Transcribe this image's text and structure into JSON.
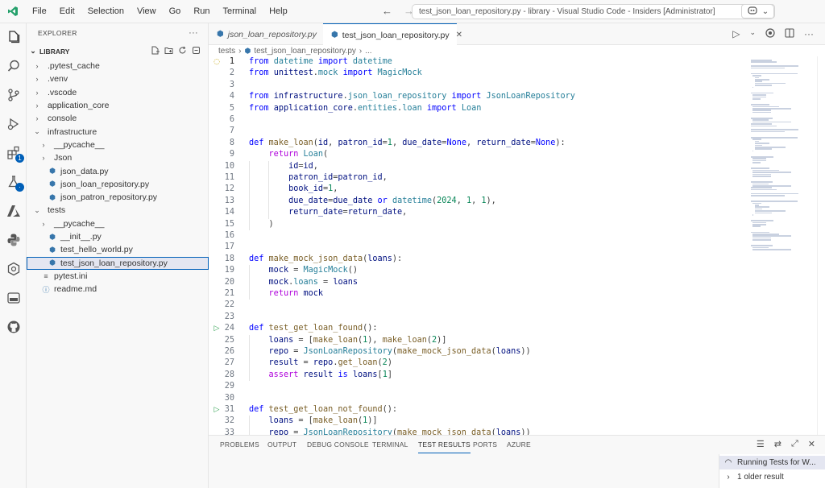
{
  "menu": [
    "File",
    "Edit",
    "Selection",
    "View",
    "Go",
    "Run",
    "Terminal",
    "Help"
  ],
  "command_center": "test_json_loan_repository.py - library - Visual Studio Code - Insiders [Administrator]",
  "explorer": {
    "title": "EXPLORER",
    "section": "LIBRARY",
    "items": [
      {
        "label": ".pytest_cache",
        "kind": "folder",
        "depth": 0,
        "open": false
      },
      {
        "label": ".venv",
        "kind": "folder",
        "depth": 0,
        "open": false
      },
      {
        "label": ".vscode",
        "kind": "folder",
        "depth": 0,
        "open": false
      },
      {
        "label": "application_core",
        "kind": "folder",
        "depth": 0,
        "open": false
      },
      {
        "label": "console",
        "kind": "folder",
        "depth": 0,
        "open": false
      },
      {
        "label": "infrastructure",
        "kind": "folder",
        "depth": 0,
        "open": true
      },
      {
        "label": "__pycache__",
        "kind": "folder",
        "depth": 1,
        "open": false
      },
      {
        "label": "Json",
        "kind": "folder",
        "depth": 1,
        "open": false
      },
      {
        "label": "json_data.py",
        "kind": "py",
        "depth": 1
      },
      {
        "label": "json_loan_repository.py",
        "kind": "py",
        "depth": 1
      },
      {
        "label": "json_patron_repository.py",
        "kind": "py",
        "depth": 1
      },
      {
        "label": "tests",
        "kind": "folder",
        "depth": 0,
        "open": true
      },
      {
        "label": "__pycache__",
        "kind": "folder",
        "depth": 1,
        "open": false
      },
      {
        "label": "__init__.py",
        "kind": "py",
        "depth": 1
      },
      {
        "label": "test_hello_world.py",
        "kind": "py",
        "depth": 1
      },
      {
        "label": "test_json_loan_repository.py",
        "kind": "py",
        "depth": 1,
        "selected": true
      },
      {
        "label": "pytest.ini",
        "kind": "ini",
        "depth": 0
      },
      {
        "label": "readme.md",
        "kind": "md",
        "depth": 0
      }
    ]
  },
  "tabs": [
    {
      "label": "json_loan_repository.py",
      "active": false
    },
    {
      "label": "test_json_loan_repository.py",
      "active": true
    }
  ],
  "breadcrumb": [
    "tests",
    "test_json_loan_repository.py",
    "..."
  ],
  "code": [
    {
      "n": "1",
      "glyph": "bulb",
      "t": "from datetime import datetime"
    },
    {
      "n": "2",
      "t": "from unittest.mock import MagicMock"
    },
    {
      "n": "3",
      "t": ""
    },
    {
      "n": "4",
      "t": "from infrastructure.json_loan_repository import JsonLoanRepository"
    },
    {
      "n": "5",
      "t": "from application_core.entities.loan import Loan"
    },
    {
      "n": "6",
      "t": ""
    },
    {
      "n": "7",
      "t": ""
    },
    {
      "n": "8",
      "t": "def make_loan(id, patron_id=1, due_date=None, return_date=None):"
    },
    {
      "n": "9",
      "t": "    return Loan("
    },
    {
      "n": "10",
      "t": "        id=id,"
    },
    {
      "n": "11",
      "t": "        patron_id=patron_id,"
    },
    {
      "n": "12",
      "t": "        book_id=1,"
    },
    {
      "n": "13",
      "t": "        due_date=due_date or datetime(2024, 1, 1),"
    },
    {
      "n": "14",
      "t": "        return_date=return_date,"
    },
    {
      "n": "15",
      "t": "    )"
    },
    {
      "n": "16",
      "t": ""
    },
    {
      "n": "17",
      "t": ""
    },
    {
      "n": "18",
      "t": "def make_mock_json_data(loans):"
    },
    {
      "n": "19",
      "t": "    mock = MagicMock()"
    },
    {
      "n": "20",
      "t": "    mock.loans = loans"
    },
    {
      "n": "21",
      "t": "    return mock"
    },
    {
      "n": "22",
      "t": ""
    },
    {
      "n": "23",
      "t": ""
    },
    {
      "n": "24",
      "glyph": "run",
      "t": "def test_get_loan_found():"
    },
    {
      "n": "25",
      "t": "    loans = [make_loan(1), make_loan(2)]"
    },
    {
      "n": "26",
      "t": "    repo = JsonLoanRepository(make_mock_json_data(loans))"
    },
    {
      "n": "27",
      "t": "    result = repo.get_loan(2)"
    },
    {
      "n": "28",
      "t": "    assert result is loans[1]"
    },
    {
      "n": "29",
      "t": ""
    },
    {
      "n": "30",
      "t": ""
    },
    {
      "n": "31",
      "glyph": "run",
      "t": "def test_get_loan_not_found():"
    },
    {
      "n": "32",
      "t": "    loans = [make_loan(1)]"
    },
    {
      "n": "33",
      "t": "    repo = JsonLoanRepository(make_mock_json_data(loans))"
    }
  ],
  "panel": {
    "tabs": [
      "PROBLEMS",
      "OUTPUT",
      "DEBUG CONSOLE",
      "TERMINAL",
      "TEST RESULTS",
      "PORTS",
      "AZURE"
    ],
    "active_tab": "TEST RESULTS",
    "results": [
      {
        "label": "Running Tests for W...",
        "icon": "spinner-icon",
        "selected": true
      },
      {
        "label": "1 older result",
        "icon": "chevron-right-icon",
        "selected": false
      }
    ]
  },
  "colors": {
    "accent": "#005fb8",
    "keyword": "#0000ff",
    "control": "#af00db",
    "function": "#795e26",
    "class": "#267f99",
    "number": "#098658"
  }
}
